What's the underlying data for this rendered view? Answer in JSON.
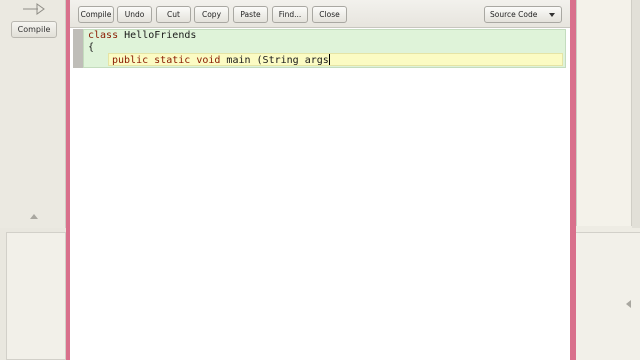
{
  "side": {
    "compile_label": "Compile"
  },
  "toolbar": {
    "compile_label": "Compile",
    "undo_label": "Undo",
    "cut_label": "Cut",
    "copy_label": "Copy",
    "paste_label": "Paste",
    "find_label": "Find...",
    "close_label": "Close",
    "view_select": "Source Code"
  },
  "code": {
    "line1_kw": "class",
    "line1_name": " HelloFriends",
    "line2": "{",
    "line3_kw1": "public",
    "line3_kw2": "static",
    "line3_kw3": "void",
    "line3_rest": " main (String args"
  },
  "colors": {
    "editor_frame": "#d9708c",
    "class_scope": "#dff3d9",
    "method_scope": "#fbfbc3",
    "keyword": "#8a1a00"
  }
}
